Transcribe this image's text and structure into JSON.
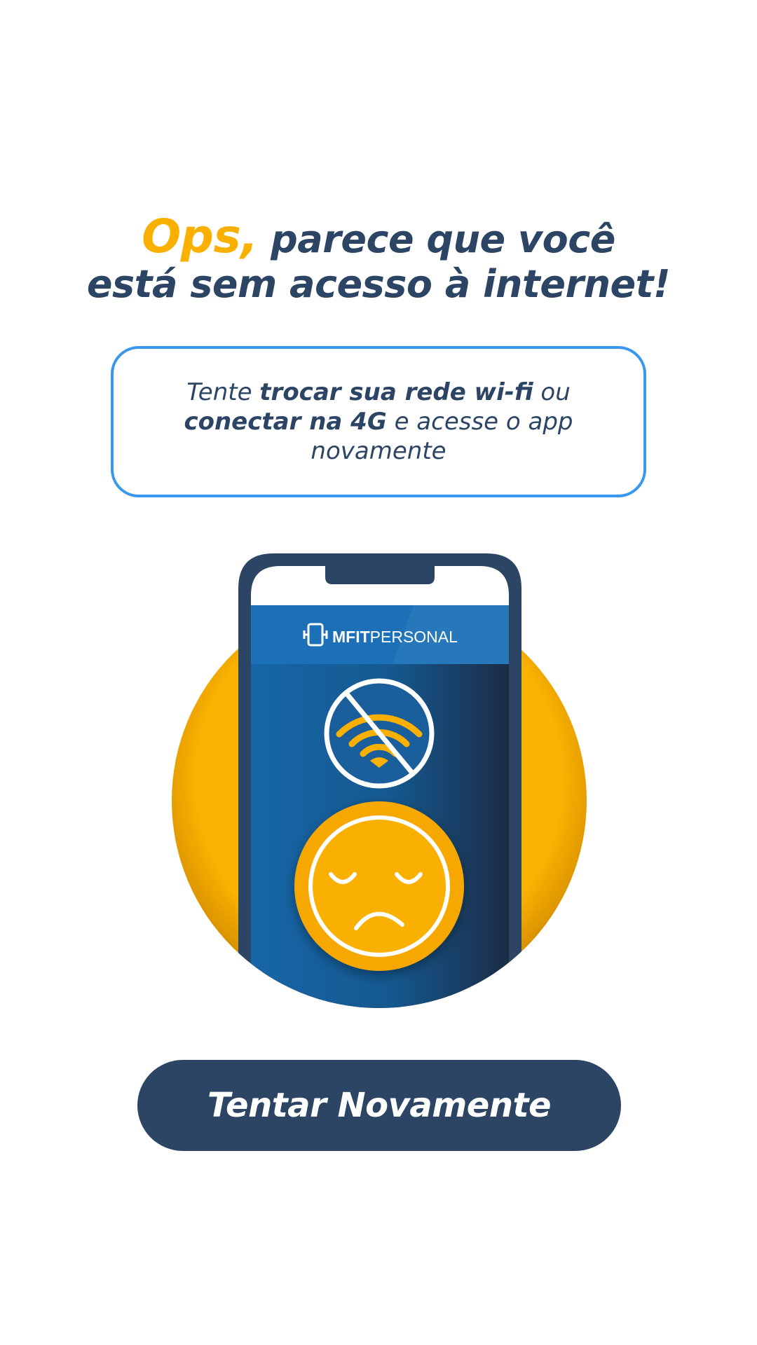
{
  "title": {
    "accent": "Ops,",
    "line1_rest": " parece que você",
    "line2": "está sem acesso à internet!"
  },
  "message": {
    "part1": "Tente ",
    "bold1": "trocar sua rede wi-fi",
    "part2": " ou ",
    "bold2": "conectar na 4G",
    "part3": " e acesse o app novamente"
  },
  "phone_screen": {
    "brand_bold": "MFIT",
    "brand_light": "PERSONAL",
    "wifi_status_icon": "no-wifi-icon",
    "mood_icon": "sad-face-icon"
  },
  "retry_button": {
    "label": "Tentar Novamente"
  },
  "colors": {
    "primary_dark": "#2c4565",
    "accent_yellow": "#f9b000",
    "box_border_blue": "#3a97ee",
    "app_header_blue": "#1c70b8"
  }
}
